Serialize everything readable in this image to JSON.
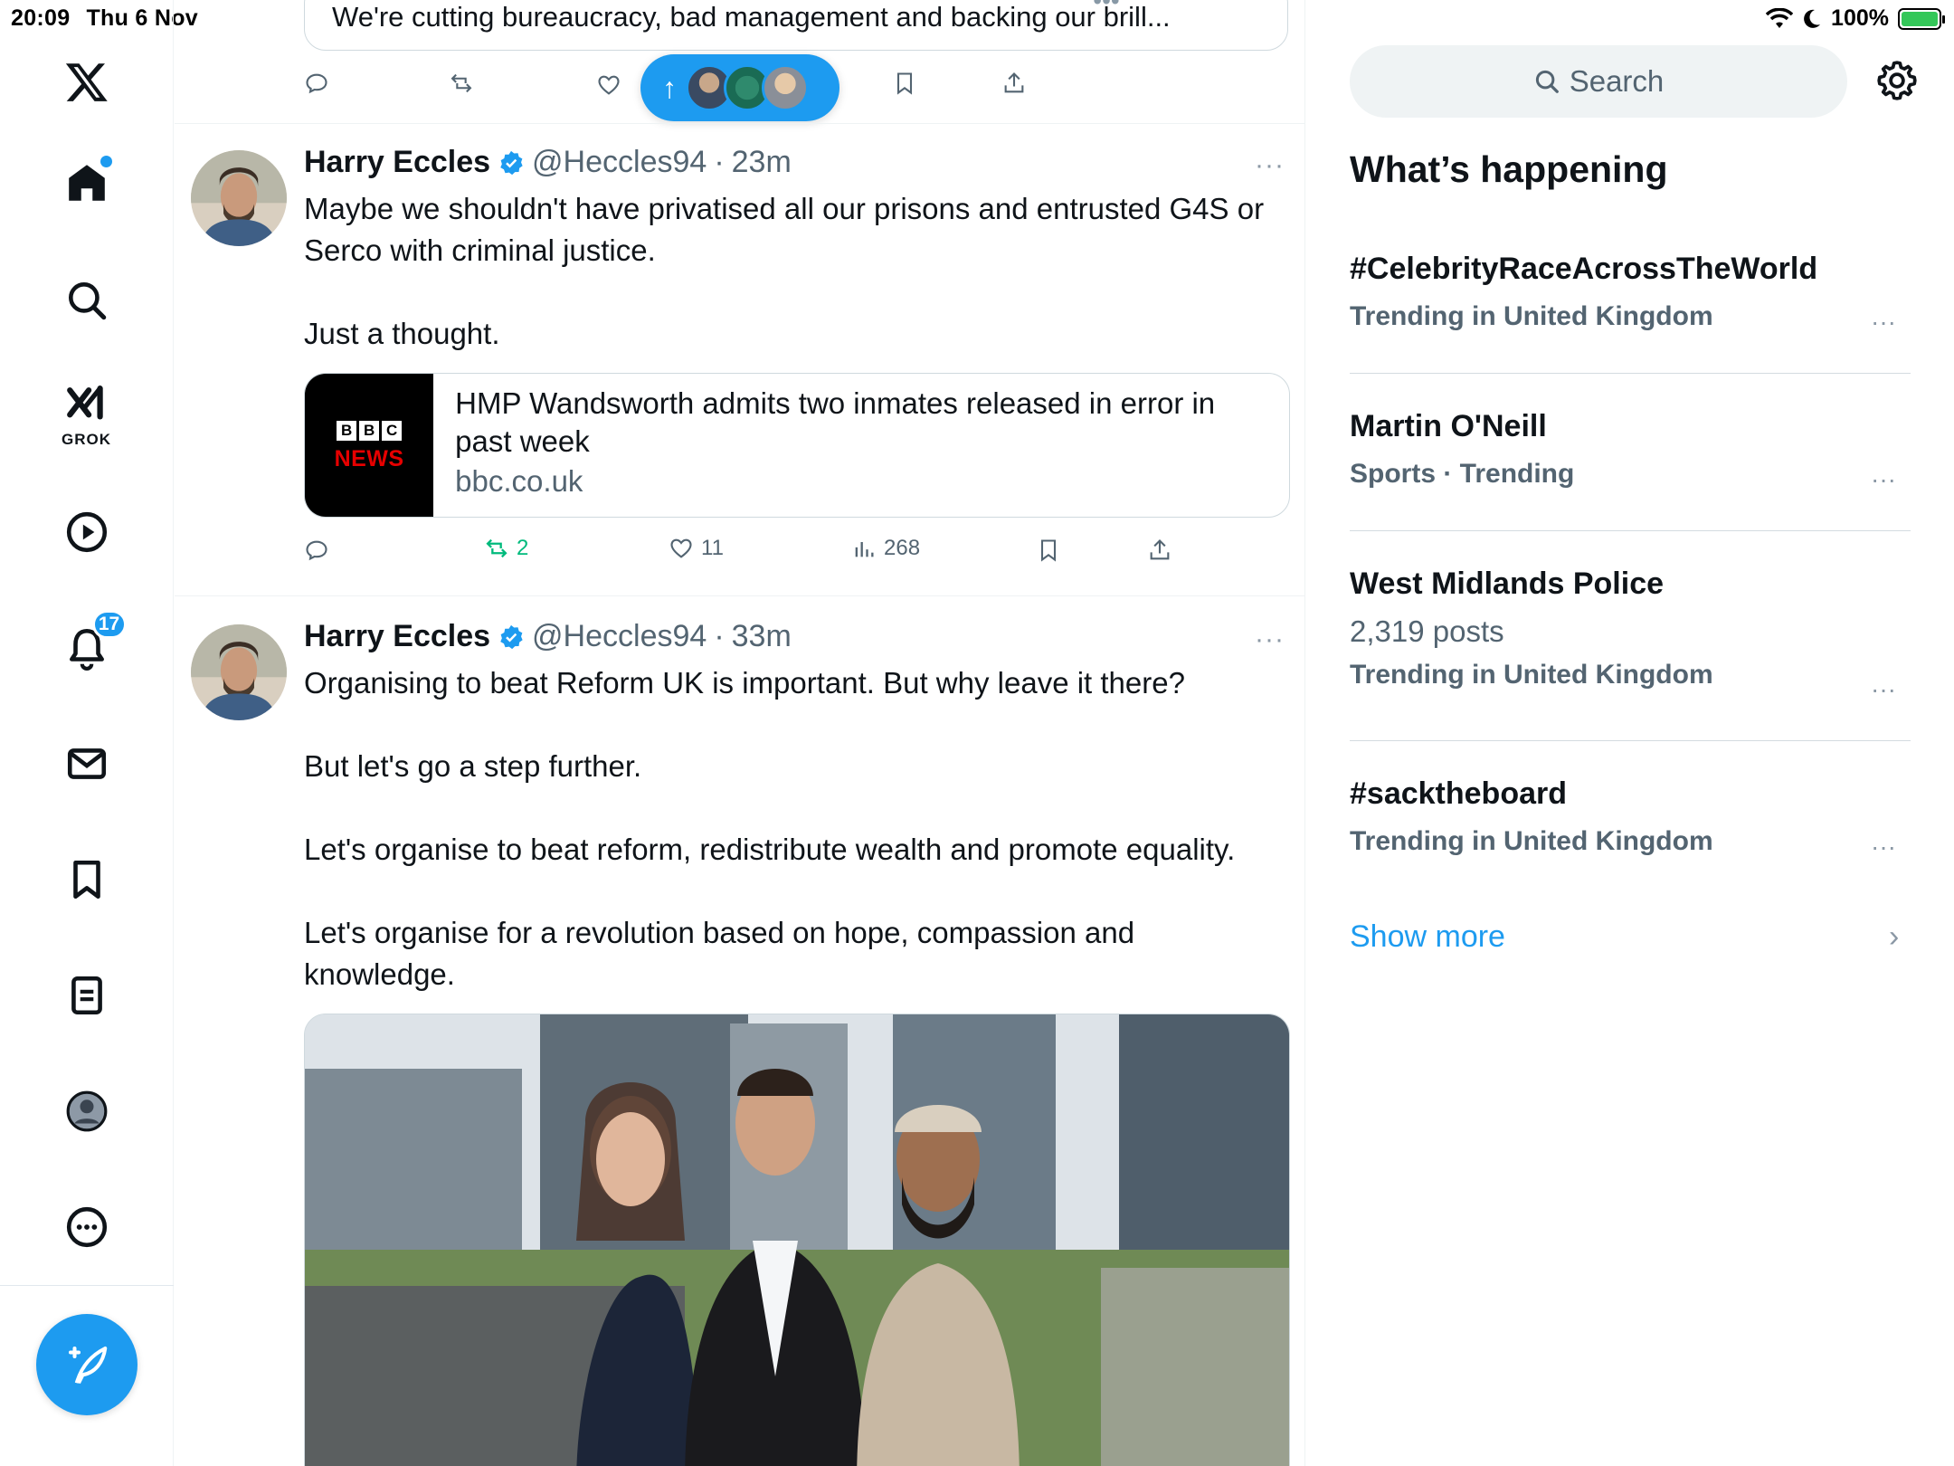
{
  "status_bar": {
    "time": "20:09",
    "date": "Thu 6 Nov",
    "battery": "100%"
  },
  "nav": {
    "grok_label": "GROK",
    "notifications_count": "17"
  },
  "previous_tweet": {
    "card_text": "We're cutting bureaucracy, bad management and backing our brill..."
  },
  "new_posts_pill": {
    "arrow": "↑"
  },
  "tweets": [
    {
      "name": "Harry Eccles",
      "handle": "@Heccles94",
      "sep": "·",
      "time": "23m",
      "more": "···",
      "paragraphs": [
        "Maybe we shouldn't have privatised all our prisons and entrusted G4S or Serco with criminal justice.",
        "Just a thought."
      ],
      "link_card": {
        "logo_blocks": [
          "B",
          "B",
          "C"
        ],
        "logo_word": "NEWS",
        "title": "HMP Wandsworth admits two inmates released in error in past week",
        "domain": "bbc.co.uk"
      },
      "stats": {
        "retweets": "2",
        "likes": "11",
        "views": "268"
      }
    },
    {
      "name": "Harry Eccles",
      "handle": "@Heccles94",
      "sep": "·",
      "time": "33m",
      "more": "···",
      "paragraphs": [
        "Organising to beat Reform UK is important. But why leave it there?",
        "But let's go a step further.",
        "Let's organise to beat reform, redistribute wealth and promote equality.",
        "Let's organise for a revolution based on hope, compassion and knowledge."
      ]
    }
  ],
  "sidebar": {
    "search_placeholder": "Search",
    "section_title": "What’s happening",
    "trends": [
      {
        "title": "#CelebrityRaceAcrossTheWorld",
        "meta": "Trending in United Kingdom",
        "count": ""
      },
      {
        "title": "Martin O'Neill",
        "meta": "Sports · Trending",
        "count": ""
      },
      {
        "title": "West Midlands Police",
        "meta": "Trending in United Kingdom",
        "count": "2,319 posts"
      },
      {
        "title": "#sacktheboard",
        "meta": "Trending in United Kingdom",
        "count": ""
      }
    ],
    "more_label": "···",
    "show_more": "Show more",
    "show_more_chevron": "›"
  },
  "colors": {
    "accent": "#1d9bf0",
    "retweet_green": "#00ba7c",
    "text_secondary": "#536471"
  }
}
